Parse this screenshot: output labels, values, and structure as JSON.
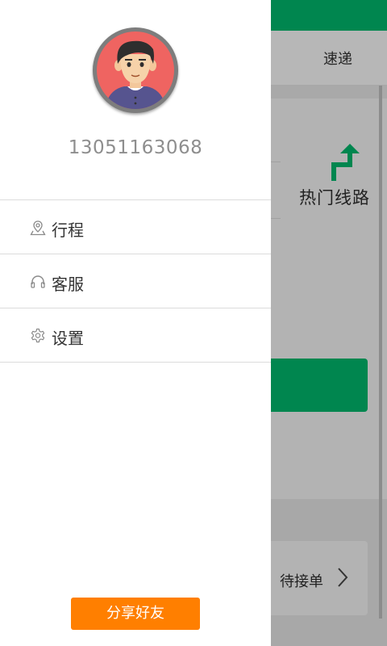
{
  "background": {
    "tab_label": "速递",
    "hot_routes_label": "热门线路",
    "pending_label": "待接单",
    "accent_color": "#00864f"
  },
  "drawer": {
    "phone": "13051163068",
    "menu": [
      {
        "label": "行程",
        "icon": "location-pin-icon"
      },
      {
        "label": "客服",
        "icon": "headset-icon"
      },
      {
        "label": "设置",
        "icon": "gear-icon"
      }
    ],
    "share_label": "分享好友",
    "share_color": "#ff7f00"
  }
}
